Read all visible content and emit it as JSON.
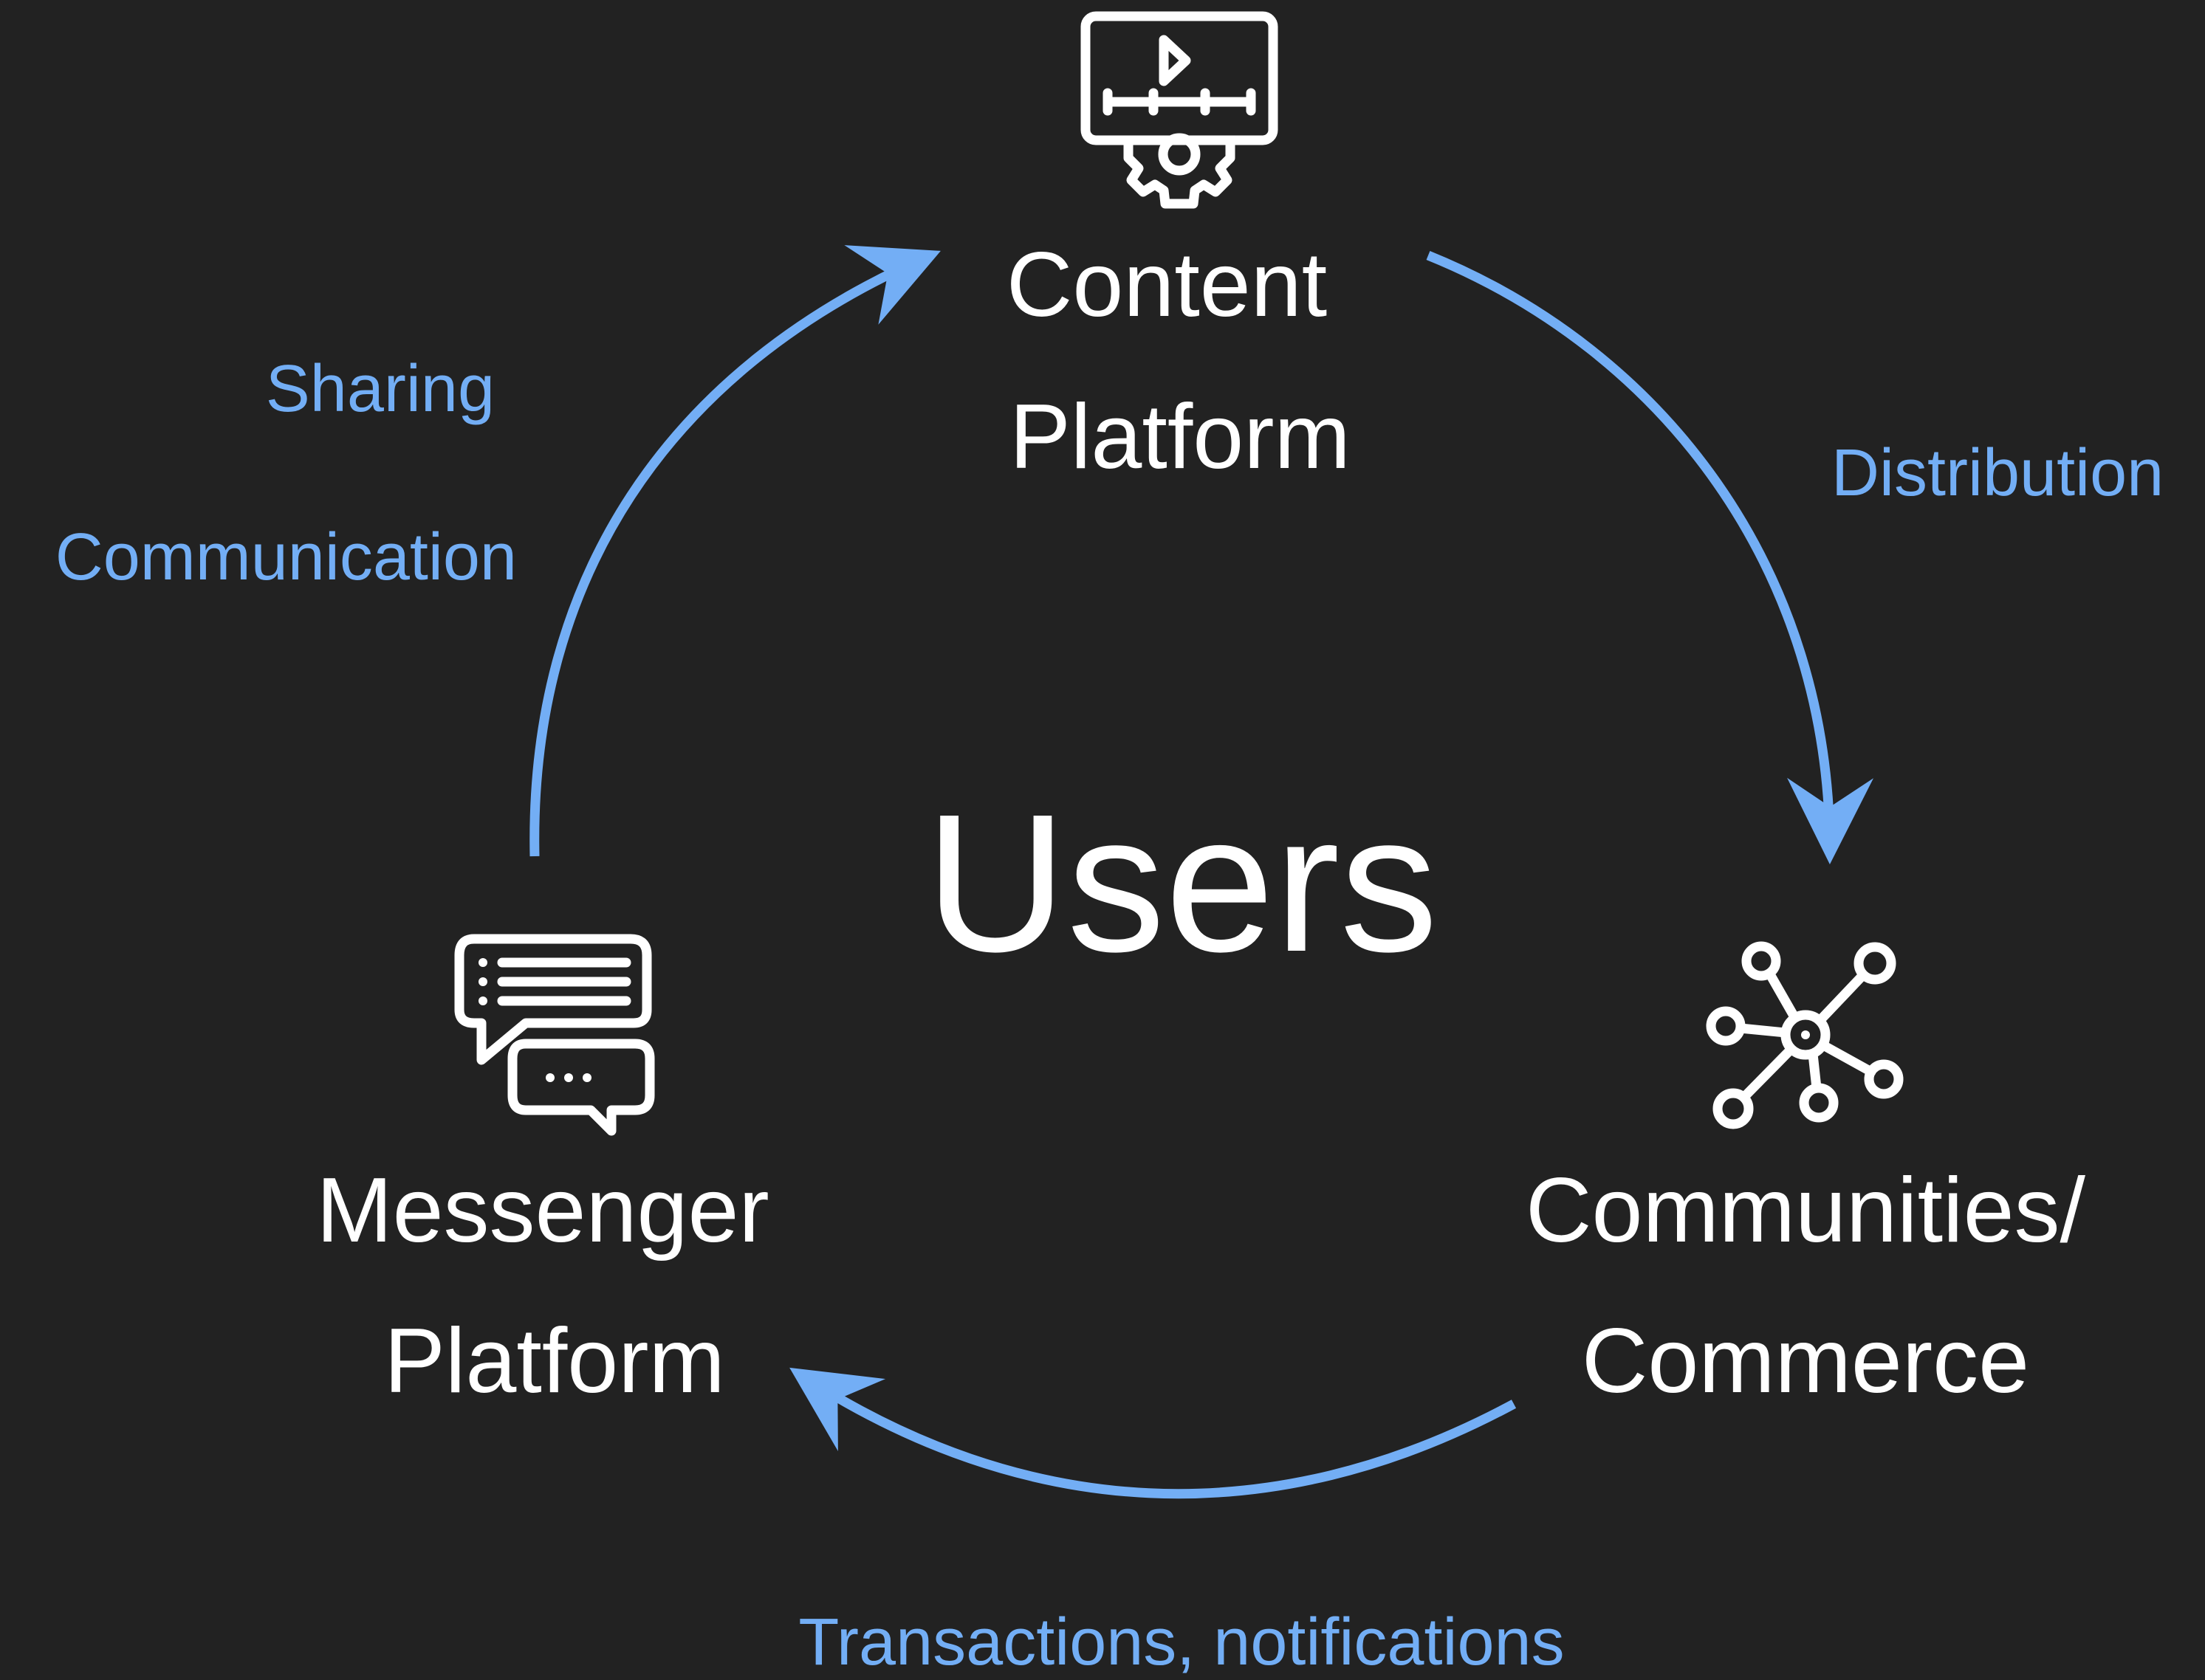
{
  "colors": {
    "background": "#222222",
    "node_text": "#ffffff",
    "arrow": "#73aef5",
    "edge_text": "#73aef5"
  },
  "center": {
    "label": "Users"
  },
  "nodes": {
    "content": {
      "icon": "video-monitor-gear-icon",
      "line1": "Content",
      "line2": "Platform"
    },
    "communities": {
      "icon": "network-nodes-icon",
      "line1": "Communities/",
      "line2": "Commerce"
    },
    "messenger": {
      "icon": "chat-bubbles-icon",
      "line1": "Messenger",
      "line2": "Platform"
    }
  },
  "edges": {
    "sharing": "Sharing",
    "communication": "Communication",
    "distribution": "Distribution",
    "transactions": "Transactions, notifications"
  }
}
